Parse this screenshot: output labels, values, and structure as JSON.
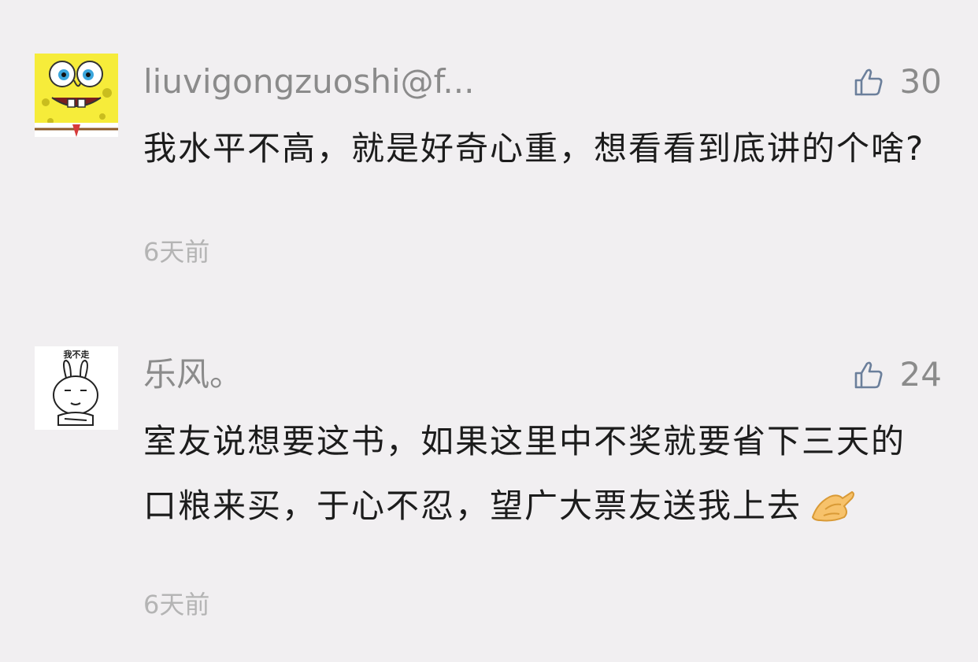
{
  "comments": [
    {
      "avatar_icon": "spongebob-avatar-icon",
      "username": "liuvigongzuoshi@f...",
      "likes": "30",
      "text": "我水平不高，就是好奇心重，想看看到底讲的个啥?",
      "time": "6天前"
    },
    {
      "avatar_icon": "bunny-avatar-icon",
      "avatar_caption": "我不走",
      "username": "乐风。",
      "likes": "24",
      "text": "室友说想要这书，如果这里中不奖就要省下三天的口粮来买，于心不忍，望广大票友送我上去",
      "emoji_icon": "pinching-hand-emoji",
      "time": "6天前"
    }
  ],
  "colors": {
    "background": "#f1eff1",
    "username": "#8b8b8b",
    "body_text": "#1c1c1c",
    "timestamp": "#b4b4b4",
    "like_icon": "#6b7f9b"
  }
}
